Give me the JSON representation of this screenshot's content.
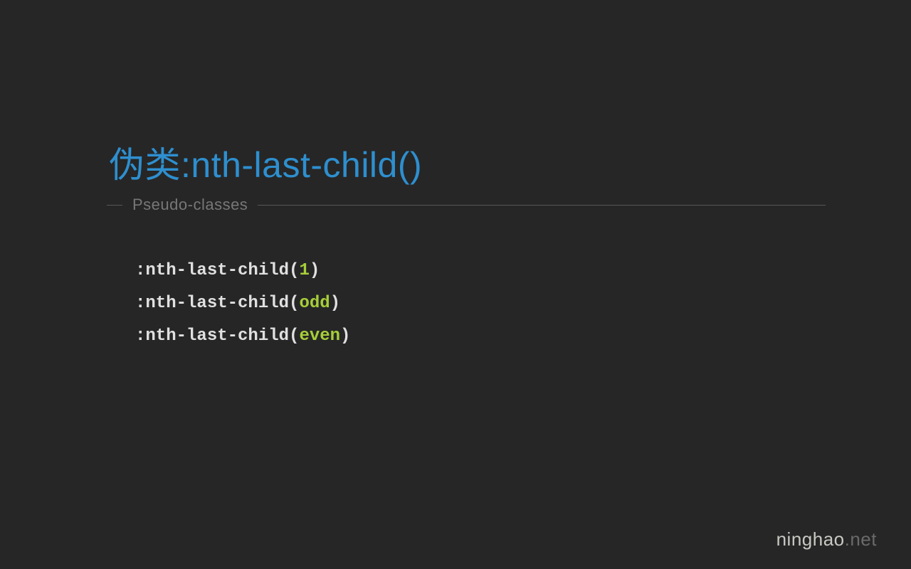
{
  "title": "伪类:nth-last-child()",
  "subtitle": "Pseudo-classes",
  "code": {
    "lines": [
      {
        "prefix": ":nth-last-child(",
        "arg": "1",
        "suffix": ")"
      },
      {
        "prefix": ":nth-last-child(",
        "arg": "odd",
        "suffix": ")"
      },
      {
        "prefix": ":nth-last-child(",
        "arg": "even",
        "suffix": ")"
      }
    ]
  },
  "watermark": {
    "part1": "ninghao",
    "part2": ".net"
  }
}
